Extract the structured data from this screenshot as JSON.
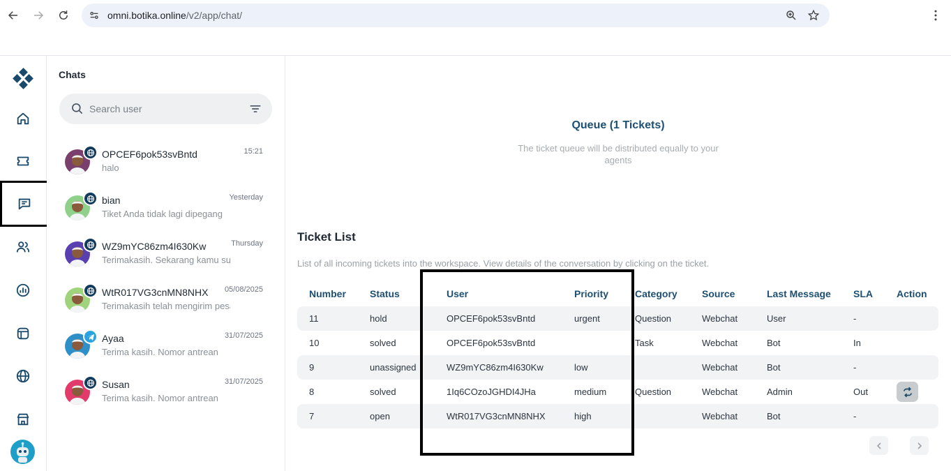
{
  "browser": {
    "url_host": "omni.botika.online",
    "url_path": "/v2/app/chat/"
  },
  "rail": {
    "items": [
      "logo-icon",
      "home-icon",
      "ticket-icon",
      "chat-icon",
      "users-icon",
      "analytics-icon",
      "inbox-icon",
      "globe-icon",
      "store-icon"
    ],
    "active": "chat-icon"
  },
  "chats": {
    "title": "Chats",
    "search_placeholder": "Search user",
    "items": [
      {
        "name": "OPCEF6pok53svBntd",
        "time": "15:21",
        "preview": "halo",
        "channel": "web",
        "avatar_color": "#7b3f6e"
      },
      {
        "name": "bian",
        "time": "Yesterday",
        "preview": "Tiket Anda tidak lagi dipegang",
        "channel": "web",
        "avatar_color": "#8fd18a"
      },
      {
        "name": "WZ9mYC86zm4I630Kw",
        "time": "Thursday",
        "preview": "Terimakasih. Sekarang kamu sudah",
        "channel": "web",
        "avatar_color": "#5a3fb0"
      },
      {
        "name": "WtR017VG3cnMN8NHX",
        "time": "05/08/2025",
        "preview": "Terimakasih telah mengirim pesan",
        "channel": "web",
        "avatar_color": "#9fd47d"
      },
      {
        "name": "Ayaa",
        "time": "31/07/2025",
        "preview": "Terima kasih. Nomor antrean",
        "channel": "telegram",
        "avatar_color": "#2f8fc9"
      },
      {
        "name": "Susan",
        "time": "31/07/2025",
        "preview": "Terima kasih. Nomor antrean",
        "channel": "web",
        "avatar_color": "#e23a6b"
      }
    ]
  },
  "queue": {
    "title": "Queue (1 Tickets)",
    "subtitle": "The ticket queue will be distributed equally to your agents"
  },
  "tickets": {
    "title": "Ticket List",
    "description": "List of all incoming tickets into the workspace. View details of the conversation by clicking on the ticket.",
    "columns": [
      "Number",
      "Status",
      "User",
      "Priority",
      "Category",
      "Source",
      "Last Message",
      "SLA",
      "Action"
    ],
    "rows": [
      {
        "number": "11",
        "status": "hold",
        "user": "OPCEF6pok53svBntd",
        "priority": "urgent",
        "category": "Question",
        "source": "Webchat",
        "last_message": "User",
        "sla": "-",
        "action": ""
      },
      {
        "number": "10",
        "status": "solved",
        "user": "OPCEF6pok53svBntd",
        "priority": "",
        "category": "Task",
        "source": "Webchat",
        "last_message": "Bot",
        "sla": "In",
        "action": ""
      },
      {
        "number": "9",
        "status": "unassigned",
        "user": "WZ9mYC86zm4I630Kw",
        "priority": "low",
        "category": "",
        "source": "Webchat",
        "last_message": "Bot",
        "sla": "-",
        "action": ""
      },
      {
        "number": "8",
        "status": "solved",
        "user": "1Iq6COzoJGHDI4JHa",
        "priority": "medium",
        "category": "Question",
        "source": "Webchat",
        "last_message": "Admin",
        "sla": "Out",
        "action": "reopen-icon"
      },
      {
        "number": "7",
        "status": "open",
        "user": "WtR017VG3cnMN8NHX",
        "priority": "high",
        "category": "",
        "source": "Webchat",
        "last_message": "Bot",
        "sla": "-",
        "action": ""
      }
    ]
  },
  "colors": {
    "accent": "#1d4f73",
    "row_shade": "#f2f3f5"
  }
}
